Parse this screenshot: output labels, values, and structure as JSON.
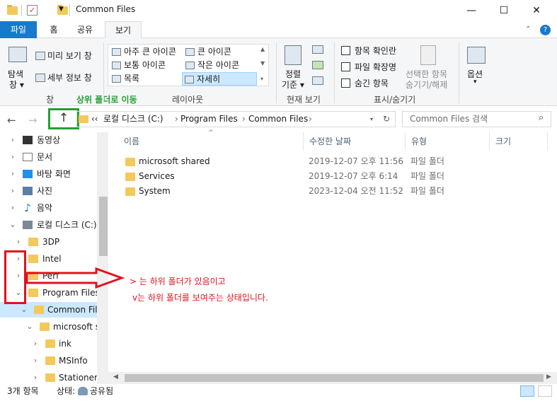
{
  "window": {
    "title": "Common Files",
    "controls": {
      "minimize": "—",
      "maximize": "☐",
      "close": "✕"
    }
  },
  "tabs": [
    "파일",
    "홈",
    "공유",
    "보기"
  ],
  "ribbon": {
    "pane_group": {
      "nav_pane_label": "탐색",
      "nav_pane_label2": "창 ▾",
      "preview_pane": "미리 보기 창",
      "details_pane": "세부 정보 창",
      "label": "창"
    },
    "layout_group": {
      "items": [
        "아주 큰 아이콘",
        "큰 아이콘",
        "보통 아이콘",
        "작은 아이콘",
        "목록",
        "자세히"
      ],
      "label": "레이아웃"
    },
    "current_view_group": {
      "sort_label": "정렬",
      "sort_label2": "기준 ▾",
      "label": "현재 보기"
    },
    "show_hide_group": {
      "checkboxes": [
        "항목 확인란",
        "파일 확장명",
        "숨긴 항목"
      ],
      "hide_selected": "선택한 항목",
      "hide_selected2": "숨기기/해제",
      "label": "표시/숨기기"
    },
    "options": {
      "label": "옵션"
    },
    "annotation": "상위 폴더로 이동"
  },
  "address": {
    "path": [
      "‹‹",
      "로컬 디스크 (C:)",
      "Program Files",
      "Common Files"
    ],
    "search_placeholder": "Common Files 검색"
  },
  "nav_tree": [
    {
      "label": "동영상",
      "icon": "video-icon"
    },
    {
      "label": "문서",
      "icon": "document-icon"
    },
    {
      "label": "바탕 화면",
      "icon": "desktop-icon"
    },
    {
      "label": "사진",
      "icon": "pictures-icon"
    },
    {
      "label": "음악",
      "icon": "music-icon"
    },
    {
      "label": "로컬 디스크 (C:)",
      "icon": "drive-icon"
    },
    {
      "label": "3DP",
      "icon": "folder-icon"
    },
    {
      "label": "Intel",
      "icon": "folder-icon"
    },
    {
      "label": "Perf",
      "icon": "folder-icon"
    },
    {
      "label": "Program Files",
      "icon": "folder-icon"
    },
    {
      "label": "Common File",
      "icon": "folder-icon"
    },
    {
      "label": "microsoft sh",
      "icon": "folder-icon"
    },
    {
      "label": "ink",
      "icon": "folder-icon"
    },
    {
      "label": "MSInfo",
      "icon": "folder-icon"
    },
    {
      "label": "Stationery",
      "icon": "folder-icon"
    }
  ],
  "columns": [
    "이름",
    "수정한 날짜",
    "유형",
    "크기"
  ],
  "files": [
    {
      "name": "microsoft shared",
      "modified": "2019-12-07 오후 11:56",
      "type": "파일 폴더"
    },
    {
      "name": "Services",
      "modified": "2019-12-07 오후 6:14",
      "type": "파일 폴더"
    },
    {
      "name": "System",
      "modified": "2023-12-04 오전 11:52",
      "type": "파일 폴더"
    }
  ],
  "annotations": {
    "line1": "> 는 하위 폴더가 있음이고",
    "line2": "v는 하위 폴더를 보여주는 상태입니다."
  },
  "status": {
    "count": "3개 항목",
    "state_label": "상태:",
    "state_value": "공유됨"
  },
  "colors": {
    "accent": "#1979ca",
    "selection": "#cce8ff",
    "annotation_red": "#e0131e",
    "annotation_green": "#22a033"
  }
}
